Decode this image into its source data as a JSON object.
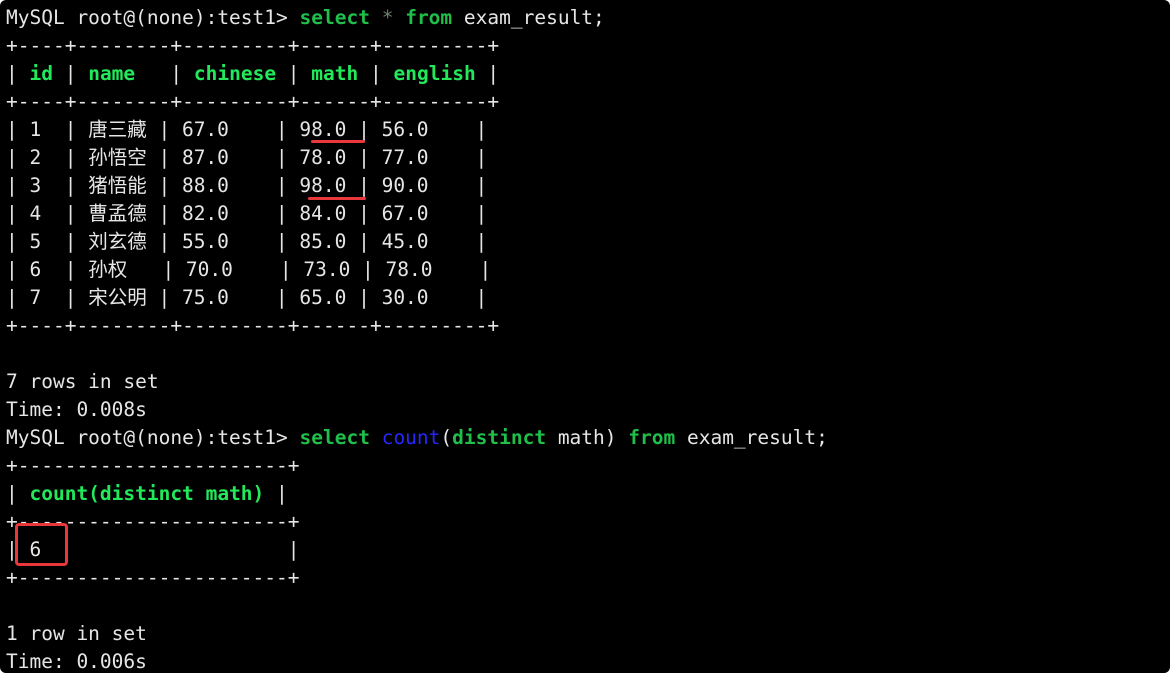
{
  "prompt1": "MySQL root@(none):test1> ",
  "query1": {
    "select": "select",
    "star": "*",
    "from": "from",
    "rest": " exam_result;"
  },
  "border1": "+----+--------+---------+------+---------+",
  "header1": {
    "id": "id",
    "name": "name",
    "chinese": "chinese",
    "math": "math",
    "english": "english"
  },
  "rows": [
    {
      "id": "1",
      "name": "唐三藏",
      "chinese": "67.0",
      "math": "98.0",
      "english": "56.0"
    },
    {
      "id": "2",
      "name": "孙悟空",
      "chinese": "87.0",
      "math": "78.0",
      "english": "77.0"
    },
    {
      "id": "3",
      "name": "猪悟能",
      "chinese": "88.0",
      "math": "98.0",
      "english": "90.0"
    },
    {
      "id": "4",
      "name": "曹孟德",
      "chinese": "82.0",
      "math": "84.0",
      "english": "67.0"
    },
    {
      "id": "5",
      "name": "刘玄德",
      "chinese": "55.0",
      "math": "85.0",
      "english": "45.0"
    },
    {
      "id": "6",
      "name": "孙权",
      "chinese": "70.0",
      "math": "73.0",
      "english": "78.0"
    },
    {
      "id": "7",
      "name": "宋公明",
      "chinese": "75.0",
      "math": "65.0",
      "english": "30.0"
    }
  ],
  "status1": "7 rows in set",
  "time1": "Time: 0.008s",
  "prompt2": "MySQL root@(none):test1> ",
  "query2": {
    "select": "select",
    "count": "count",
    "paren_open": "(",
    "distinct": "distinct",
    "middle": " math) ",
    "from": "from",
    "rest": " exam_result;"
  },
  "border2": "+-----------------------+",
  "header2": "count(distinct math)",
  "result2": "6",
  "status2": "1 row in set",
  "time2": "Time: 0.006s",
  "colors": {
    "background": "#000000",
    "keyword": "#1fbf4a",
    "function": "#2626ff",
    "header": "#22e85a",
    "annotation": "#e8383b"
  }
}
